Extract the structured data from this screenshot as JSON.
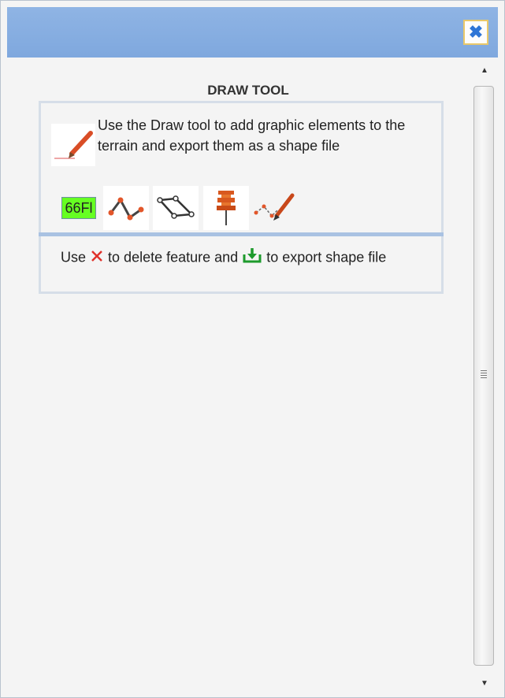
{
  "window": {
    "close_icon": "close-icon",
    "colors": {
      "titlebar": "#8fb4e4",
      "close_glyph": "#2f76d6",
      "close_border": "#e9c86a",
      "panel_border": "#d6dee8",
      "divider": "#a9c2e2"
    }
  },
  "panel": {
    "title": "DRAW TOOL",
    "intro_icon": "pencil-icon",
    "intro_text": "Use the Draw tool to add graphic elements to the terrain and export them as a shape file",
    "tools": [
      {
        "name": "text-tool",
        "label": "66Fl",
        "color": "#66ff22"
      },
      {
        "name": "polyline-tool",
        "icon": "polyline-icon"
      },
      {
        "name": "polygon-tool",
        "icon": "polygon-icon"
      },
      {
        "name": "pin-tool",
        "icon": "pin-icon"
      },
      {
        "name": "freehand-tool",
        "icon": "freehand-draw-icon"
      }
    ],
    "help": {
      "part1": "Use",
      "delete_icon": "delete-x-icon",
      "part2": "to delete feature and",
      "export_icon": "export-download-icon",
      "part3": "to export shape file"
    }
  },
  "scrollbar": {
    "up_icon": "scroll-up-arrow-icon",
    "down_icon": "scroll-down-arrow-icon",
    "grip_icon": "scroll-grip-icon"
  }
}
